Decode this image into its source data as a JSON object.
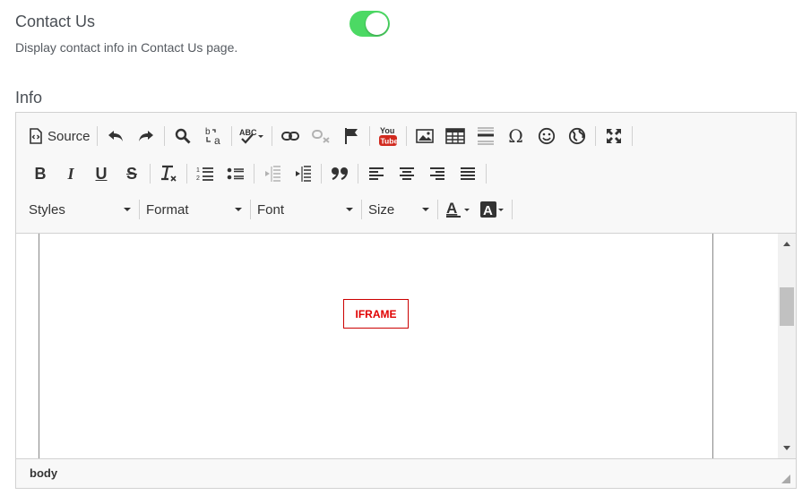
{
  "setting": {
    "title": "Contact Us",
    "description": "Display contact info in Contact Us page.",
    "enabled": true,
    "toggle_color": "#4cd964"
  },
  "info_label": "Info",
  "toolbar": {
    "source_label": "Source",
    "styles_label": "Styles",
    "format_label": "Format",
    "font_label": "Font",
    "size_label": "Size",
    "bold_glyph": "B",
    "italic_glyph": "I",
    "underline_glyph": "U",
    "strike_glyph": "S",
    "special_char_glyph": "Ω",
    "youtube_top": "You",
    "youtube_bottom": "Tube"
  },
  "editor": {
    "iframe_placeholder": "IFRAME",
    "iframe_color": "#e00000",
    "path": "body"
  }
}
